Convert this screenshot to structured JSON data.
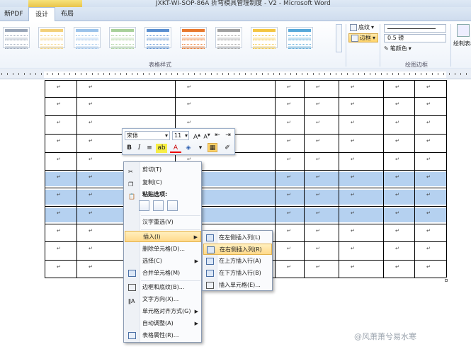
{
  "window": {
    "title": "JXKT-WI-SOP-86A 折弯模具管理制度 - V2 - Microsoft Word"
  },
  "tabs": [
    {
      "label": "新PDF"
    },
    {
      "label": "设计"
    },
    {
      "label": "布局"
    }
  ],
  "ribbon": {
    "table_styles_group": "表格样式",
    "draw_borders_group": "绘图边框",
    "shading_label": "底纹",
    "borders_label": "边框",
    "line_weight": "0.5 磅",
    "pen_color_label": "笔颜色",
    "draw_table_label": "绘制表格",
    "style_colors": [
      "#9aa6b8",
      "#f3d07a",
      "#9cc3ea",
      "#a8d09a",
      "#5b8fd0",
      "#e8792e",
      "#a0a0a0",
      "#f4c542",
      "#57a8d9"
    ]
  },
  "table": {
    "cell_mark": "↵",
    "selected_color": "#b5d1f0"
  },
  "mini_toolbar": {
    "font": "宋体",
    "size": "11"
  },
  "context_menu": {
    "items": [
      {
        "label": "剪切(T)",
        "icon": "scissors-icon"
      },
      {
        "label": "复制(C)",
        "icon": "copy-icon"
      },
      {
        "label": "粘贴选项:",
        "icon": "paste-icon"
      },
      {
        "label": "汉字重选(V)",
        "icon": ""
      },
      {
        "label": "插入(I)",
        "icon": ""
      },
      {
        "label": "删除单元格(D)...",
        "icon": ""
      },
      {
        "label": "选择(C)",
        "icon": ""
      },
      {
        "label": "合并单元格(M)",
        "icon": "merge-cells-icon"
      },
      {
        "label": "边框和底纹(B)...",
        "icon": "borders-shading-icon"
      },
      {
        "label": "文字方向(X)...",
        "icon": "text-direction-icon"
      },
      {
        "label": "单元格对齐方式(G)",
        "icon": ""
      },
      {
        "label": "自动调整(A)",
        "icon": ""
      },
      {
        "label": "表格属性(R)...",
        "icon": "table-properties-icon"
      }
    ]
  },
  "insert_submenu": {
    "items": [
      {
        "label": "在左侧插入列(L)"
      },
      {
        "label": "在右侧插入列(R)"
      },
      {
        "label": "在上方插入行(A)"
      },
      {
        "label": "在下方插入行(B)"
      },
      {
        "label": "插入单元格(E)..."
      }
    ]
  },
  "watermark": "@风萧萧兮易水寒"
}
